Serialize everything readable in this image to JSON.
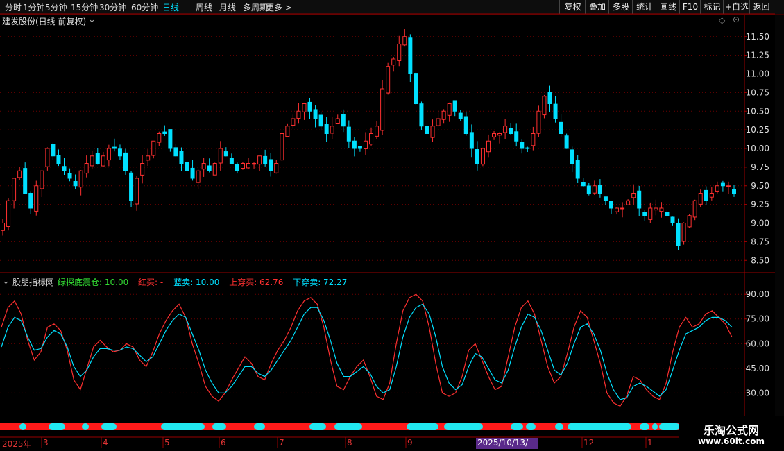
{
  "toolbar": {
    "periods": [
      "分时",
      "1分钟",
      "5分钟",
      "15分钟",
      "30分钟",
      "60分钟",
      "日线",
      "周线",
      "月线",
      "多周期",
      "更多"
    ],
    "active": "日线",
    "right": [
      "复权",
      "叠加",
      "多股",
      "统计",
      "画线",
      "F10",
      "标记",
      "+自选",
      "返回"
    ]
  },
  "main_panel": {
    "title": "建发股份(日线 前复权)",
    "chevron_icon": "chevron-down-icon",
    "diamond_icon": "diamond-icon",
    "close_icon": "close-icon"
  },
  "indicator_panel": {
    "name": "股朋指标网",
    "chevron_icon": "chevron-down-icon",
    "items": [
      {
        "label": "绿探底震仓:",
        "value": "10.00",
        "color": "#33dd33"
      },
      {
        "label": "红买:",
        "value": "-",
        "color": "#ff3030"
      },
      {
        "label": "蓝卖:",
        "value": "10.00",
        "color": "#00e0ff"
      },
      {
        "label": "上穿买:",
        "value": "62.76",
        "color": "#ff3030"
      },
      {
        "label": "下穿卖:",
        "value": "72.27",
        "color": "#00e0ff"
      }
    ]
  },
  "date_axis": {
    "year": "2025年",
    "months": [
      "3",
      "4",
      "5",
      "6",
      "7",
      "8",
      "9",
      "12",
      "1"
    ],
    "highlight": "2025/10/13/—"
  },
  "watermark": {
    "title": "乐淘公式网",
    "url": "www.60lt.com"
  },
  "colors": {
    "up": "#ff3030",
    "down": "#00e0ff",
    "grid": "#6a0000",
    "bg": "#000000"
  },
  "chart_data": [
    {
      "type": "candlestick",
      "title": "建发股份(日线 前复权)",
      "y_ticks": [
        8.5,
        8.75,
        9.0,
        9.25,
        9.5,
        9.75,
        10.0,
        10.25,
        10.5,
        10.75,
        11.0,
        11.25,
        11.5
      ],
      "ylim": [
        8.4,
        11.6
      ],
      "close_series": [
        9.0,
        9.3,
        9.6,
        9.7,
        9.4,
        9.2,
        9.5,
        9.7,
        10.0,
        9.9,
        9.8,
        9.7,
        9.6,
        9.5,
        9.7,
        9.8,
        9.9,
        9.8,
        9.9,
        10.0,
        10.0,
        9.9,
        9.7,
        9.3,
        9.6,
        9.8,
        9.9,
        10.1,
        10.2,
        10.2,
        10.0,
        9.9,
        9.8,
        9.7,
        9.6,
        9.7,
        9.8,
        9.7,
        9.8,
        10.0,
        9.9,
        9.8,
        9.7,
        9.8,
        9.8,
        9.8,
        9.9,
        9.8,
        9.7,
        9.8,
        10.2,
        10.3,
        10.4,
        10.5,
        10.6,
        10.5,
        10.4,
        10.3,
        10.2,
        10.3,
        10.4,
        10.3,
        10.1,
        10.0,
        10.0,
        10.1,
        10.2,
        10.3,
        10.8,
        11.1,
        11.2,
        11.4,
        11.5,
        11.0,
        10.6,
        10.3,
        10.2,
        10.3,
        10.4,
        10.5,
        10.6,
        10.5,
        10.4,
        10.2,
        10.0,
        9.8,
        10.0,
        10.1,
        10.2,
        10.2,
        10.3,
        10.2,
        10.1,
        10.0,
        10.0,
        10.2,
        10.5,
        10.7,
        10.6,
        10.4,
        10.2,
        10.0,
        9.8,
        9.6,
        9.5,
        9.4,
        9.5,
        9.4,
        9.3,
        9.2,
        9.2,
        9.2,
        9.3,
        9.4,
        9.2,
        9.1,
        9.2,
        9.2,
        9.2,
        9.1,
        9.0,
        8.7,
        9.0,
        9.1,
        9.3,
        9.4,
        9.3,
        9.4,
        9.5,
        9.5,
        9.5,
        9.4
      ]
    },
    {
      "type": "line",
      "title": "股朋指标网",
      "y_ticks": [
        30.0,
        45.0,
        60.0,
        75.0,
        90.0
      ],
      "ylim": [
        20,
        96
      ],
      "series": [
        {
          "name": "上穿买",
          "color": "#ff3030",
          "values": [
            70,
            82,
            86,
            78,
            62,
            50,
            55,
            70,
            72,
            68,
            56,
            38,
            32,
            45,
            58,
            62,
            58,
            55,
            56,
            60,
            58,
            50,
            46,
            55,
            66,
            74,
            80,
            84,
            76,
            60,
            48,
            34,
            28,
            25,
            30,
            38,
            45,
            52,
            48,
            40,
            38,
            48,
            56,
            62,
            70,
            80,
            86,
            88,
            84,
            70,
            50,
            34,
            32,
            40,
            46,
            50,
            40,
            28,
            26,
            36,
            60,
            80,
            88,
            90,
            86,
            70,
            48,
            30,
            28,
            30,
            40,
            56,
            60,
            50,
            40,
            32,
            34,
            52,
            70,
            82,
            86,
            78,
            62,
            46,
            36,
            40,
            54,
            70,
            80,
            76,
            62,
            48,
            30,
            24,
            22,
            28,
            40,
            38,
            32,
            28,
            26,
            36,
            55,
            70,
            76,
            70,
            72,
            78,
            80,
            76,
            72,
            64
          ]
        },
        {
          "name": "下穿卖",
          "color": "#00e0ff",
          "values": [
            58,
            70,
            76,
            74,
            64,
            56,
            57,
            64,
            68,
            66,
            58,
            46,
            40,
            44,
            52,
            57,
            57,
            56,
            56,
            58,
            57,
            53,
            49,
            52,
            60,
            68,
            74,
            78,
            76,
            66,
            56,
            44,
            36,
            30,
            30,
            34,
            40,
            46,
            46,
            42,
            40,
            44,
            50,
            56,
            62,
            70,
            78,
            82,
            82,
            74,
            62,
            48,
            40,
            40,
            43,
            46,
            42,
            34,
            30,
            32,
            46,
            64,
            76,
            82,
            84,
            78,
            64,
            46,
            36,
            32,
            35,
            46,
            54,
            52,
            45,
            38,
            36,
            44,
            58,
            70,
            78,
            76,
            68,
            56,
            44,
            41,
            48,
            60,
            70,
            72,
            66,
            56,
            42,
            32,
            26,
            27,
            34,
            36,
            34,
            31,
            28,
            32,
            44,
            56,
            66,
            68,
            70,
            74,
            76,
            76,
            74,
            70
          ]
        }
      ]
    }
  ]
}
